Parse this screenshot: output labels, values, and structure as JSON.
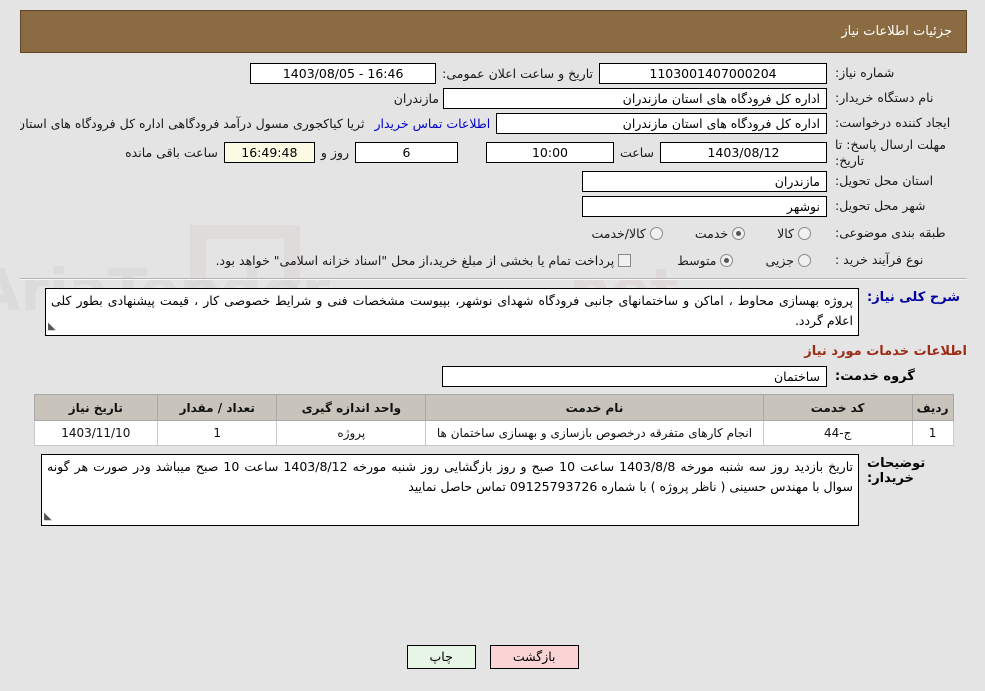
{
  "header": {
    "title": "جزئیات اطلاعات نیاز"
  },
  "fields": {
    "need_number_label": "شماره نیاز:",
    "need_number_value": "1103001407000204",
    "public_announce_label": "تاریخ و ساعت اعلان عمومی:",
    "public_announce_value": "16:46 - 1403/08/05",
    "buyer_org_label": "نام دستگاه خریدار:",
    "buyer_org_value": "اداره کل فرودگاه های استان مازندران",
    "buyer_org_overflow": "مازندران",
    "creator_label": "ایجاد کننده درخواست:",
    "creator_value": "ثریا کیاکجوری مسول درآمد فرودگاهی اداره کل فرودگاه های استان مازندران",
    "creator_short": "اداره کل فرودگاه های استان مازندران",
    "creator_overflow": "ثریا کیاکجوری مسول درآمد فرودگاهی اداره کل فرودگاه های استان مازندران",
    "contact_link": "اطلاعات تماس خریدار",
    "deadline_label": "مهلت ارسال پاسخ: تا تاریخ:",
    "deadline_date": "1403/08/12",
    "deadline_time_label": "ساعت",
    "deadline_time": "10:00",
    "remaining_days": "6",
    "remaining_days_label": "روز و",
    "remaining_clock": "16:49:48",
    "remaining_clock_label": "ساعت باقی مانده",
    "province_label": "استان محل تحویل:",
    "province_value": "مازندران",
    "city_label": "شهر محل تحویل:",
    "city_value": "نوشهر",
    "category_label": "طبقه بندی موضوعی:",
    "process_label": "نوع فرآیند خرید :"
  },
  "category_options": [
    {
      "label": "کالا",
      "selected": false
    },
    {
      "label": "خدمت",
      "selected": true
    },
    {
      "label": "کالا/خدمت",
      "selected": false
    }
  ],
  "process_options": [
    {
      "label": "جزیی",
      "selected": false
    },
    {
      "label": "متوسط",
      "selected": true
    }
  ],
  "treasury": {
    "checked": false,
    "note": "پرداخت تمام یا بخشی از مبلغ خرید،از محل \"اسناد خزانه اسلامی\" خواهد بود."
  },
  "need_description": {
    "label": "شرح کلی نیاز:",
    "text": "پروژه بهسازی محاوط ، اماکن و ساختمانهای جانبی فرودگاه شهدای نوشهر، بپیوست مشخصات فنی و شرایط خصوصی کار ، قیمت پیشنهادی بطور کلی اعلام گردد."
  },
  "services_section": {
    "heading": "اطلاعات خدمات مورد نیاز",
    "group_label": "گروه خدمت:",
    "group_value": "ساختمان"
  },
  "table": {
    "headers": [
      "ردیف",
      "کد خدمت",
      "نام خدمت",
      "واحد اندازه گیری",
      "تعداد / مقدار",
      "تاریخ نیاز"
    ],
    "rows": [
      {
        "radif": "1",
        "code": "ج-44",
        "name": "انجام کارهای متفرقه درخصوص بازسازی و بهسازی ساختمان ها",
        "unit": "پروژه",
        "qty": "1",
        "date": "1403/11/10"
      }
    ]
  },
  "buyer_notes": {
    "label": "توضیحات خریدار:",
    "text": "تاریخ بازدید روز سه شنبه مورخه 1403/8/8 ساعت 10 صبح و روز بازگشایی روز شنبه مورخه 1403/8/12 ساعت 10 صبح میباشد ودر صورت هر گونه سوال با مهندس حسینی ( ناظر پروژه ) با شماره 09125793726 تماس حاصل نمایید"
  },
  "buttons": {
    "print": "چاپ",
    "back": "بازگشت"
  },
  "watermark": {
    "text": "AriaTender.net"
  },
  "colors": {
    "header_bg": "#8b6b42",
    "accent_red": "#9b2d18",
    "link_blue": "#0000cc",
    "label_blue": "#0000a0",
    "print_btn": "#e7f5e7",
    "back_btn": "#fad4d4",
    "table_header": "#c8c4bc",
    "page_bg": "#e4e4e4"
  }
}
